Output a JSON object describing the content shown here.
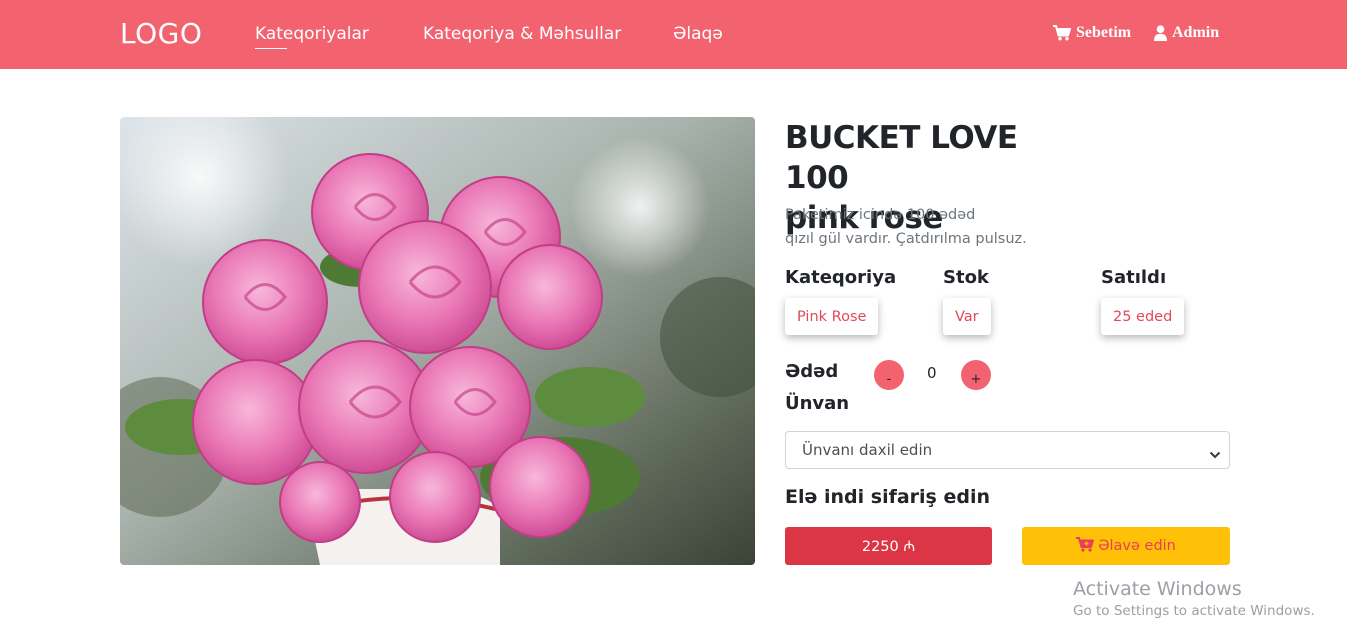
{
  "colors": {
    "navbar": "#f2636f",
    "accent": "#e04a5a",
    "price_button": "#dc3545",
    "add_button": "#ffc107"
  },
  "navbar": {
    "logo": "LOGO",
    "links": [
      "Kateqoriyalar",
      "Kateqoriya & Məhsullar",
      "Əlaqə"
    ],
    "active_link": "Kateqoriyalar",
    "cart": {
      "icon": "shopping-cart-icon",
      "label": "Sebetim"
    },
    "user": {
      "icon": "user-icon",
      "label": "Admin"
    }
  },
  "product": {
    "image": "pink-roses-bouquet-image",
    "title_line1": "BUCKET LOVE 100",
    "title_line2": "pink rose",
    "description_line1": "Paketimiz icində 100 ədəd",
    "description_line2": "qızıl gül vardır. Çatdırılma pulsuz.",
    "category_label": "Kateqoriya",
    "category_value": "Pink Rose",
    "stock_label": "Stok",
    "stock_value": "Var",
    "sold_label": "Satıldı",
    "sold_value": "25 eded",
    "quantity_label": "Ədəd",
    "quantity_minus": "-",
    "quantity_value": "0",
    "quantity_plus": "+",
    "address_label": "Ünvan",
    "address_placeholder": "Ünvanı daxil edin",
    "order_heading": "Elə indi sifariş edin",
    "price_button": "2250 ₼",
    "add_button": {
      "icon": "cart-plus-icon",
      "label": "Əlavə edin"
    }
  },
  "os_watermark": {
    "title": "Activate Windows",
    "subtitle": "Go to Settings to activate Windows."
  }
}
